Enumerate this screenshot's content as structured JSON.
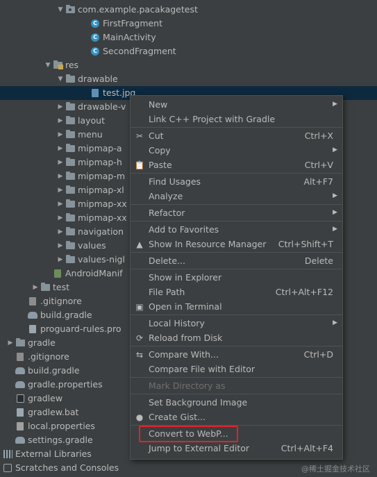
{
  "tree": [
    {
      "label": "com.example.pacakagetest",
      "indent": 94,
      "arrow": "▼",
      "icon": "folder-pkg"
    },
    {
      "label": "FirstFragment",
      "indent": 130,
      "arrow": "",
      "icon": "class"
    },
    {
      "label": "MainActivity",
      "indent": 130,
      "arrow": "",
      "icon": "class"
    },
    {
      "label": "SecondFragment",
      "indent": 130,
      "arrow": "",
      "icon": "class"
    },
    {
      "label": "res",
      "indent": 76,
      "arrow": "▼",
      "icon": "folder-res"
    },
    {
      "label": "drawable",
      "indent": 94,
      "arrow": "▼",
      "icon": "folder"
    },
    {
      "label": "test.jpg",
      "indent": 130,
      "arrow": "",
      "icon": "image",
      "selected": true
    },
    {
      "label": "drawable-v",
      "indent": 94,
      "arrow": "▶",
      "icon": "folder"
    },
    {
      "label": "layout",
      "indent": 94,
      "arrow": "▶",
      "icon": "folder"
    },
    {
      "label": "menu",
      "indent": 94,
      "arrow": "▶",
      "icon": "folder"
    },
    {
      "label": "mipmap-a",
      "indent": 94,
      "arrow": "▶",
      "icon": "folder"
    },
    {
      "label": "mipmap-h",
      "indent": 94,
      "arrow": "▶",
      "icon": "folder"
    },
    {
      "label": "mipmap-m",
      "indent": 94,
      "arrow": "▶",
      "icon": "folder"
    },
    {
      "label": "mipmap-xl",
      "indent": 94,
      "arrow": "▶",
      "icon": "folder"
    },
    {
      "label": "mipmap-xx",
      "indent": 94,
      "arrow": "▶",
      "icon": "folder"
    },
    {
      "label": "mipmap-xx",
      "indent": 94,
      "arrow": "▶",
      "icon": "folder"
    },
    {
      "label": "navigation",
      "indent": 94,
      "arrow": "▶",
      "icon": "folder"
    },
    {
      "label": "values",
      "indent": 94,
      "arrow": "▶",
      "icon": "folder"
    },
    {
      "label": "values-nigl",
      "indent": 94,
      "arrow": "▶",
      "icon": "folder"
    },
    {
      "label": "AndroidManif",
      "indent": 76,
      "arrow": "",
      "icon": "manifest"
    },
    {
      "label": "test",
      "indent": 58,
      "arrow": "▶",
      "icon": "folder"
    },
    {
      "label": ".gitignore",
      "indent": 40,
      "arrow": "",
      "icon": "git"
    },
    {
      "label": "build.gradle",
      "indent": 40,
      "arrow": "",
      "icon": "gradle"
    },
    {
      "label": "proguard-rules.pro",
      "indent": 40,
      "arrow": "",
      "icon": "file"
    },
    {
      "label": "gradle",
      "indent": 22,
      "arrow": "▶",
      "icon": "folder"
    },
    {
      "label": ".gitignore",
      "indent": 22,
      "arrow": "",
      "icon": "git"
    },
    {
      "label": "build.gradle",
      "indent": 22,
      "arrow": "",
      "icon": "gradle"
    },
    {
      "label": "gradle.properties",
      "indent": 22,
      "arrow": "",
      "icon": "gradle"
    },
    {
      "label": "gradlew",
      "indent": 22,
      "arrow": "",
      "icon": "terminal"
    },
    {
      "label": "gradlew.bat",
      "indent": 22,
      "arrow": "",
      "icon": "file"
    },
    {
      "label": "local.properties",
      "indent": 22,
      "arrow": "",
      "icon": "props"
    },
    {
      "label": "settings.gradle",
      "indent": 22,
      "arrow": "",
      "icon": "gradle"
    },
    {
      "label": "External Libraries",
      "indent": 4,
      "arrow": "▶",
      "icon": "libs"
    },
    {
      "label": "Scratches and Consoles",
      "indent": 4,
      "arrow": "",
      "icon": "scratch"
    }
  ],
  "menu": [
    {
      "type": "item",
      "label": "New",
      "shortcut": "",
      "submenu": true,
      "icon": ""
    },
    {
      "type": "item",
      "label": "Link C++ Project with Gradle",
      "shortcut": "",
      "submenu": false,
      "icon": ""
    },
    {
      "type": "sep"
    },
    {
      "type": "item",
      "label": "Cut",
      "shortcut": "Ctrl+X",
      "submenu": false,
      "icon": "scissors-icon"
    },
    {
      "type": "item",
      "label": "Copy",
      "shortcut": "",
      "submenu": true,
      "icon": ""
    },
    {
      "type": "item",
      "label": "Paste",
      "shortcut": "Ctrl+V",
      "submenu": false,
      "icon": "clipboard-icon"
    },
    {
      "type": "sep"
    },
    {
      "type": "item",
      "label": "Find Usages",
      "shortcut": "Alt+F7",
      "submenu": false,
      "icon": ""
    },
    {
      "type": "item",
      "label": "Analyze",
      "shortcut": "",
      "submenu": true,
      "icon": ""
    },
    {
      "type": "sep"
    },
    {
      "type": "item",
      "label": "Refactor",
      "shortcut": "",
      "submenu": true,
      "icon": ""
    },
    {
      "type": "sep"
    },
    {
      "type": "item",
      "label": "Add to Favorites",
      "shortcut": "",
      "submenu": true,
      "icon": ""
    },
    {
      "type": "item",
      "label": "Show In Resource Manager",
      "shortcut": "Ctrl+Shift+T",
      "submenu": false,
      "icon": "resource-manager-icon"
    },
    {
      "type": "sep"
    },
    {
      "type": "item",
      "label": "Delete...",
      "shortcut": "Delete",
      "submenu": false,
      "icon": ""
    },
    {
      "type": "sep"
    },
    {
      "type": "item",
      "label": "Show in Explorer",
      "shortcut": "",
      "submenu": false,
      "icon": ""
    },
    {
      "type": "item",
      "label": "File Path",
      "shortcut": "Ctrl+Alt+F12",
      "submenu": false,
      "icon": ""
    },
    {
      "type": "item",
      "label": "Open in Terminal",
      "shortcut": "",
      "submenu": false,
      "icon": "terminal-icon"
    },
    {
      "type": "sep"
    },
    {
      "type": "item",
      "label": "Local History",
      "shortcut": "",
      "submenu": true,
      "icon": ""
    },
    {
      "type": "item",
      "label": "Reload from Disk",
      "shortcut": "",
      "submenu": false,
      "icon": "reload-icon"
    },
    {
      "type": "sep"
    },
    {
      "type": "item",
      "label": "Compare With...",
      "shortcut": "Ctrl+D",
      "submenu": false,
      "icon": "compare-icon"
    },
    {
      "type": "item",
      "label": "Compare File with Editor",
      "shortcut": "",
      "submenu": false,
      "icon": ""
    },
    {
      "type": "sep"
    },
    {
      "type": "item",
      "label": "Mark Directory as",
      "shortcut": "",
      "submenu": false,
      "icon": "",
      "disabled": true
    },
    {
      "type": "sep"
    },
    {
      "type": "item",
      "label": "Set Background Image",
      "shortcut": "",
      "submenu": false,
      "icon": ""
    },
    {
      "type": "item",
      "label": "Create Gist...",
      "shortcut": "",
      "submenu": false,
      "icon": "github-icon"
    },
    {
      "type": "sep"
    },
    {
      "type": "item",
      "label": "Convert to WebP...",
      "shortcut": "",
      "submenu": false,
      "icon": "",
      "highlighted": true
    },
    {
      "type": "item",
      "label": "Jump to External Editor",
      "shortcut": "Ctrl+Alt+F4",
      "submenu": false,
      "icon": ""
    }
  ],
  "watermark": "@稀土掘金技术社区",
  "colors": {
    "background": "#3c3f41",
    "selection": "#0d293e",
    "highlight_box": "#e0232b",
    "text": "#bbbbbb",
    "disabled_text": "#6f6f6f"
  }
}
